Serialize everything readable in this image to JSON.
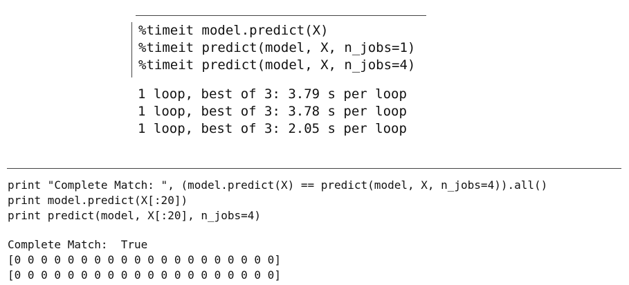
{
  "top_cell": {
    "code_lines": [
      "%timeit model.predict(X)",
      "%timeit predict(model, X, n_jobs=1)",
      "%timeit predict(model, X, n_jobs=4)"
    ],
    "output_lines": [
      "1 loop, best of 3: 3.79 s per loop",
      "1 loop, best of 3: 3.78 s per loop",
      "1 loop, best of 3: 2.05 s per loop"
    ]
  },
  "bottom_cell": {
    "code_lines": [
      "print \"Complete Match: \", (model.predict(X) == predict(model, X, n_jobs=4)).all()",
      "print model.predict(X[:20])",
      "print predict(model, X[:20], n_jobs=4)"
    ],
    "output_lines": [
      "Complete Match:  True",
      "[0 0 0 0 0 0 0 0 0 0 0 0 0 0 0 0 0 0 0 0]",
      "[0 0 0 0 0 0 0 0 0 0 0 0 0 0 0 0 0 0 0 0]"
    ]
  }
}
